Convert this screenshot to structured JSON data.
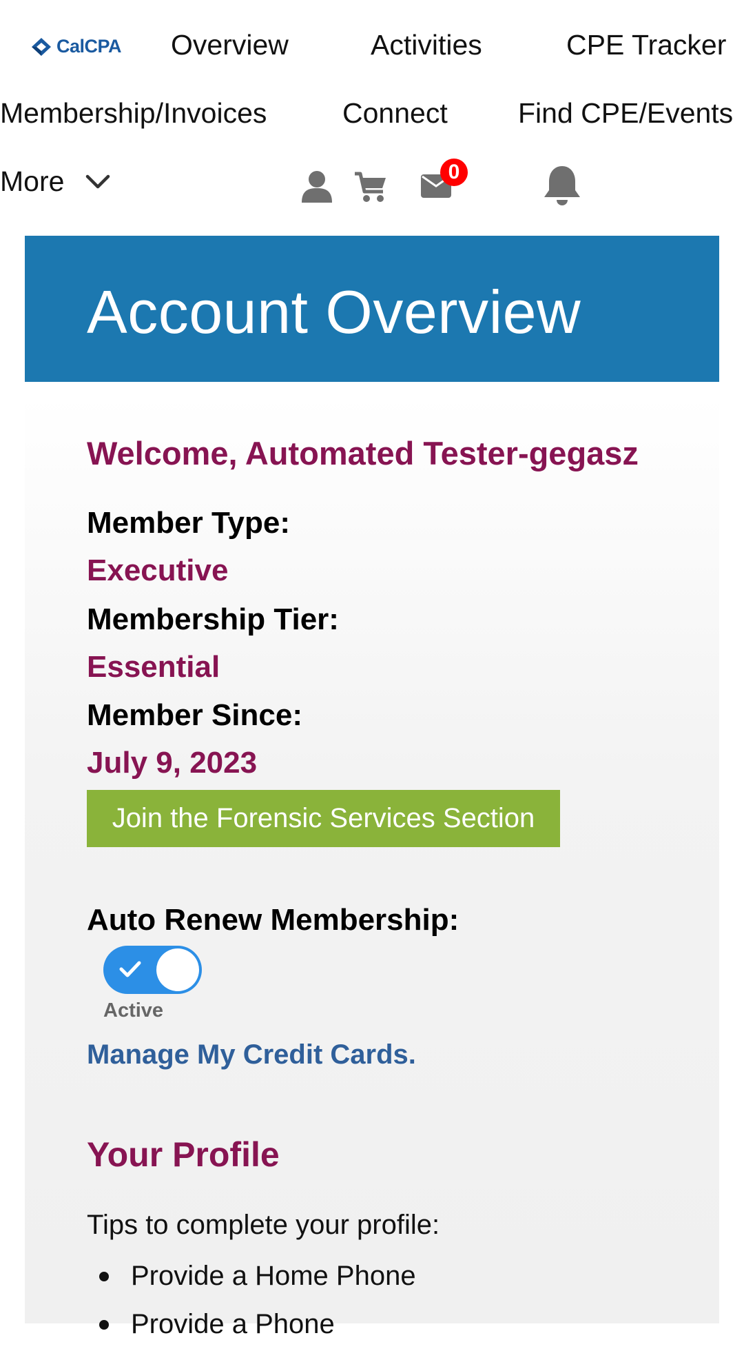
{
  "brand": {
    "logo_text": "CalCPA"
  },
  "nav": {
    "row1": [
      "Overview",
      "Activities",
      "CPE Tracker"
    ],
    "row2": [
      "Membership/Invoices",
      "Connect",
      "Find CPE/Events"
    ],
    "more_label": "More",
    "messages_count": "0",
    "icons": [
      "user-icon",
      "cart-icon",
      "mail-icon",
      "bell-icon",
      "chevron-down-icon"
    ]
  },
  "banner": {
    "title": "Account Overview"
  },
  "account": {
    "welcome": "Welcome, Automated Tester-gegasz",
    "member_type_label": "Member Type:",
    "member_type_value": "Executive",
    "tier_label": "Membership Tier:",
    "tier_value": "Essential",
    "since_label": "Member Since:",
    "since_value": "July 9, 2023",
    "join_button": "Join the Forensic Services Section",
    "auto_renew_label": "Auto Renew Membership:",
    "auto_renew_status": "Active",
    "manage_cards_link": "Manage My Credit Cards."
  },
  "profile": {
    "title": "Your Profile",
    "tips_intro": "Tips to complete your profile:",
    "tips": [
      "Provide a Home Phone",
      "Provide a Phone"
    ]
  },
  "colors": {
    "banner": "#1c78b0",
    "accent": "#871452",
    "button_green": "#8ab33a",
    "toggle_blue": "#2c8fe6",
    "link_blue": "#2f5f9a",
    "badge_red": "#ff0000"
  }
}
